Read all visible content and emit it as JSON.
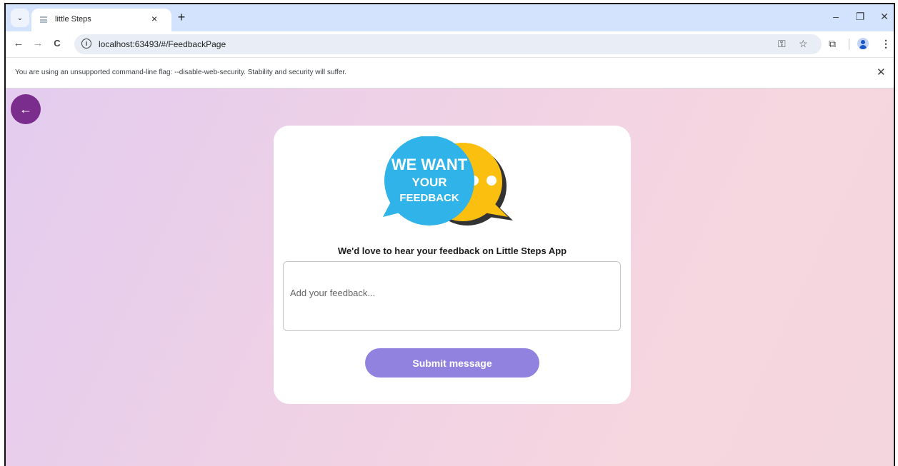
{
  "browser": {
    "tab": {
      "title": "little Steps",
      "close_glyph": "×"
    },
    "tab_list_glyph": "⌄",
    "new_tab_glyph": "+",
    "window_controls": {
      "minimize": "–",
      "restore": "❐",
      "close": "✕"
    },
    "nav": {
      "back": "←",
      "forward": "→",
      "reload": "C"
    },
    "address": {
      "info_glyph": "i",
      "url": "localhost:63493/#/FeedbackPage"
    },
    "icons": {
      "password": "key-icon",
      "bookmark": "star-icon",
      "extensions": "puzzle-icon",
      "profile": "profile-avatar-icon",
      "menu": "kebab-menu-icon"
    },
    "glyphs": {
      "key": "⚿",
      "star": "☆",
      "puzzle": "⧉",
      "menu": "⋮"
    }
  },
  "infobar": {
    "message": "You are using an unsupported command-line flag: --disable-web-security. Stability and security will suffer.",
    "close_glyph": "✕"
  },
  "page": {
    "back_glyph": "←",
    "logo": {
      "line1": "WE WANT",
      "line2": "YOUR",
      "line3": "FEEDBACK"
    },
    "prompt": "We'd love to hear your feedback on Little Steps App",
    "feedback": {
      "placeholder": "Add your feedback...",
      "value": ""
    },
    "submit_label": "Submit message",
    "colors": {
      "accent_purple": "#7b2d8e",
      "button": "#9182e0",
      "bubble_blue": "#2fb3e8",
      "bubble_yellow": "#fbbf0f",
      "bubble_shadow": "#333333"
    }
  }
}
